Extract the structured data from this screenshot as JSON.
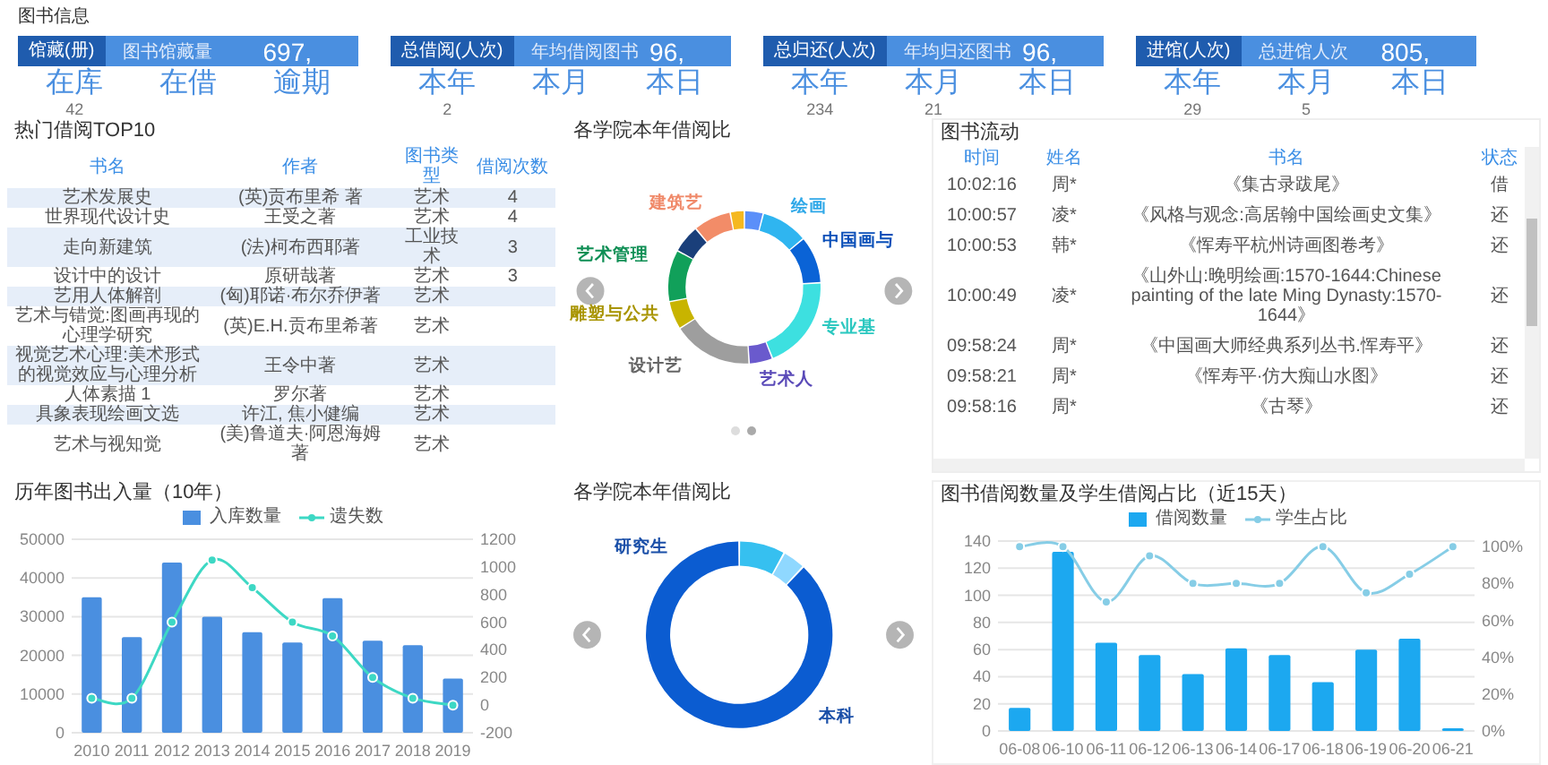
{
  "header": {
    "title": "图书信息"
  },
  "stat_cards": [
    {
      "label": "馆藏(册)",
      "sublabel": "图书馆藏量",
      "value": "697,",
      "items": [
        {
          "label": "在库",
          "value": "42"
        },
        {
          "label": "在借"
        },
        {
          "label": "逾期"
        }
      ]
    },
    {
      "label": "总借阅(人次)",
      "sublabel": "年均借阅图书",
      "value": "96,",
      "items": [
        {
          "label": "本年",
          "value": "2"
        },
        {
          "label": "本月"
        },
        {
          "label": "本日"
        }
      ]
    },
    {
      "label": "总归还(人次)",
      "sublabel": "年均归还图书",
      "value": "96,",
      "items": [
        {
          "label": "本年",
          "value": "234"
        },
        {
          "label": "本月",
          "value": "21"
        },
        {
          "label": "本日"
        }
      ]
    },
    {
      "label": "进馆(人次)",
      "sublabel": "总进馆人次",
      "value": "805,",
      "items": [
        {
          "label": "本年",
          "value": "29"
        },
        {
          "label": "本月",
          "value": "5"
        },
        {
          "label": "本日"
        }
      ]
    }
  ],
  "top_borrowed": {
    "title": "热门借阅TOP10",
    "columns": [
      "书名",
      "作者",
      "图书类型",
      "借阅次数"
    ],
    "rows": [
      {
        "title": "艺术发展史",
        "author": "(英)贡布里希 著",
        "type": "艺术",
        "count": "4"
      },
      {
        "title": "世界现代设计史",
        "author": "王受之著",
        "type": "艺术",
        "count": "4"
      },
      {
        "title": "走向新建筑",
        "author": "(法)柯布西耶著",
        "type": "工业技术",
        "count": "3"
      },
      {
        "title": "设计中的设计",
        "author": "原研哉著",
        "type": "艺术",
        "count": "3"
      },
      {
        "title": "艺用人体解剖",
        "author": "(匈)耶诺·布尔乔伊著",
        "type": "艺术"
      },
      {
        "title": "艺术与错觉:图画再现的心理学研究",
        "author": "(英)E.H.贡布里希著",
        "type": "艺术"
      },
      {
        "title": "视觉艺术心理:美术形式的视觉效应与心理分析",
        "author": "王令中著",
        "type": "艺术"
      },
      {
        "title": "人体素描 1",
        "author": "罗尔著",
        "type": "艺术"
      },
      {
        "title": "具象表现绘画文选",
        "author": "许江, 焦小健编",
        "type": "艺术"
      },
      {
        "title": "艺术与视知觉",
        "author": "(美)鲁道夫·阿恩海姆著",
        "type": "艺术"
      }
    ]
  },
  "college_share": {
    "title": "各学院本年借阅比",
    "labels": [
      {
        "text": "建筑艺",
        "color": "#f08a6a"
      },
      {
        "text": "绘画",
        "color": "#2fa8e8"
      },
      {
        "text": "中国画与",
        "color": "#0a4fb8"
      },
      {
        "text": "艺术管理",
        "color": "#0f8f55"
      },
      {
        "text": "雕塑与公共",
        "color": "#a89400"
      },
      {
        "text": "设计艺",
        "color": "#666666"
      },
      {
        "text": "艺术人",
        "color": "#5a4ab8"
      },
      {
        "text": "专业基",
        "color": "#2cc8c0"
      }
    ],
    "page_dots": [
      {
        "selected": false
      },
      {
        "selected": true
      }
    ]
  },
  "book_flow": {
    "title": "图书流动",
    "columns": [
      "时间",
      "姓名",
      "书名",
      "状态"
    ],
    "rows": [
      {
        "time": "10:02:16",
        "name": "周*",
        "book": "《集古录跋尾》",
        "state": "借"
      },
      {
        "time": "10:00:57",
        "name": "凌*",
        "book": "《风格与观念:高居翰中国绘画史文集》",
        "state": "还"
      },
      {
        "time": "10:00:53",
        "name": "韩*",
        "book": "《恽寿平杭州诗画图卷考》",
        "state": "还"
      },
      {
        "time": "10:00:49",
        "name": "凌*",
        "book": "《山外山:晚明绘画:1570-1644:Chinese painting of the late Ming Dynasty:1570-1644》",
        "state": "还"
      },
      {
        "time": "09:58:24",
        "name": "周*",
        "book": "《中国画大师经典系列丛书.恽寿平》",
        "state": "还"
      },
      {
        "time": "09:58:21",
        "name": "周*",
        "book": "《恽寿平·仿大痴山水图》",
        "state": "还"
      },
      {
        "time": "09:58:16",
        "name": "周*",
        "book": "《古琴》",
        "state": "还"
      }
    ]
  },
  "yearly_flow": {
    "chart_data": {
      "type": "bar",
      "title": "历年图书出入量（10年）",
      "categories": [
        "2010",
        "2011",
        "2012",
        "2013",
        "2014",
        "2015",
        "2016",
        "2017",
        "2018",
        "2019"
      ],
      "series": [
        {
          "name": "入库数量",
          "type": "bar",
          "color": "#4a8fe0",
          "values": [
            35000,
            24700,
            44000,
            30000,
            26000,
            23300,
            34800,
            23800,
            22600,
            14000
          ]
        },
        {
          "name": "遗失数",
          "type": "line",
          "axis": "y2",
          "marker": true,
          "color": "#3dd8c4",
          "values": [
            50,
            50,
            600,
            1050,
            850,
            600,
            500,
            200,
            50,
            0
          ]
        }
      ],
      "grid": true,
      "ylim": [
        0,
        50000
      ],
      "yticks": [
        0,
        10000,
        20000,
        30000,
        40000,
        50000
      ],
      "y2lim": [
        -200,
        1200
      ],
      "y2ticks": [
        -200,
        0,
        200,
        400,
        600,
        800,
        1000,
        1200
      ]
    }
  },
  "student_share": {
    "title": "各学院本年借阅比",
    "labels": [
      {
        "text": "研究生",
        "color": "#1a4fa8"
      },
      {
        "text": "本科",
        "color": "#1a4fa8"
      }
    ]
  },
  "daily_borrow": {
    "chart_data": {
      "type": "bar",
      "title": "图书借阅数量及学生借阅占比（近15天）",
      "categories": [
        "06-08",
        "06-10",
        "06-11",
        "06-12",
        "06-13",
        "06-14",
        "06-17",
        "06-18",
        "06-19",
        "06-20",
        "06-21"
      ],
      "series": [
        {
          "name": "借阅数量",
          "type": "bar",
          "color": "#1ca8f0",
          "values": [
            17,
            132,
            65,
            56,
            42,
            61,
            56,
            36,
            60,
            68,
            2
          ]
        },
        {
          "name": "学生占比",
          "type": "line",
          "axis": "y2",
          "marker": true,
          "color": "#86cde6",
          "values": [
            1.0,
            1.0,
            0.7,
            0.95,
            0.8,
            0.8,
            0.8,
            1.0,
            0.75,
            0.85,
            1.0
          ]
        }
      ],
      "grid": true,
      "ylim": [
        0,
        140
      ],
      "yticks": [
        0,
        20,
        40,
        60,
        80,
        100,
        120,
        140
      ],
      "y2lim": [
        0,
        1.03
      ],
      "y2ticks": [
        {
          "value": 0,
          "label": "0%"
        },
        {
          "value": 0.2,
          "label": "20%"
        },
        {
          "value": 0.4,
          "label": "40%"
        },
        {
          "value": 0.6,
          "label": "60%"
        },
        {
          "value": 0.8,
          "label": "80%"
        },
        {
          "value": 1.0,
          "label": "100%"
        }
      ]
    }
  }
}
